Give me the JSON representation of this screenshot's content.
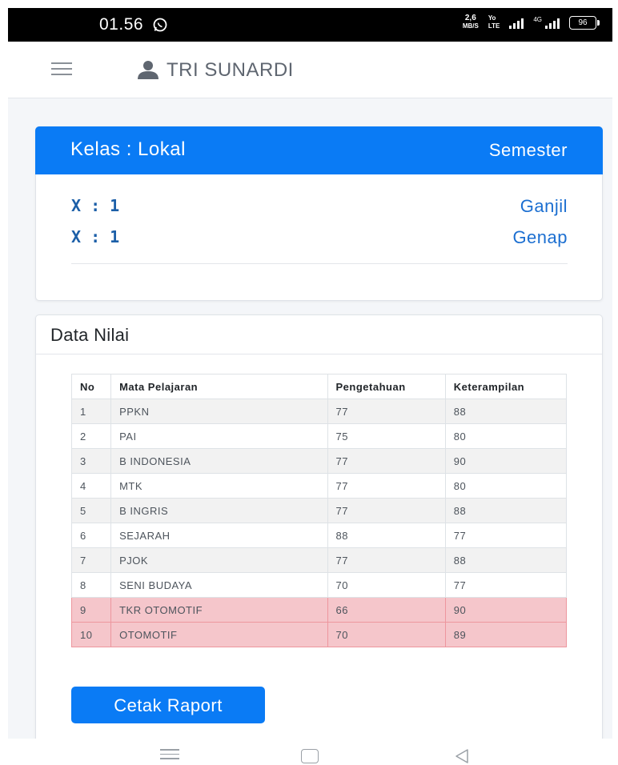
{
  "status_bar": {
    "time": "01.56",
    "speed_value": "2,6",
    "speed_unit": "MB/S",
    "lte_top": "Yo",
    "lte_bottom": "LTE",
    "network": "4G",
    "battery": "96"
  },
  "header": {
    "user_name": "TRI SUNARDI"
  },
  "kelas_card": {
    "title": "Kelas : Lokal",
    "semester_label": "Semester",
    "rows": [
      {
        "kelas": "X : 1",
        "semester": "Ganjil"
      },
      {
        "kelas": "X : 1",
        "semester": "Genap"
      }
    ]
  },
  "nilai_card": {
    "title": "Data Nilai",
    "columns": [
      "No",
      "Mata Pelajaran",
      "Pengetahuan",
      "Keterampilan"
    ],
    "rows": [
      {
        "no": "1",
        "mapel": "PPKN",
        "pengetahuan": "77",
        "keterampilan": "88"
      },
      {
        "no": "2",
        "mapel": "PAI",
        "pengetahuan": "75",
        "keterampilan": "80"
      },
      {
        "no": "3",
        "mapel": "B INDONESIA",
        "pengetahuan": "77",
        "keterampilan": "90"
      },
      {
        "no": "4",
        "mapel": "MTK",
        "pengetahuan": "77",
        "keterampilan": "80"
      },
      {
        "no": "5",
        "mapel": "B INGRIS",
        "pengetahuan": "77",
        "keterampilan": "88"
      },
      {
        "no": "6",
        "mapel": "SEJARAH",
        "pengetahuan": "88",
        "keterampilan": "77"
      },
      {
        "no": "7",
        "mapel": "PJOK",
        "pengetahuan": "77",
        "keterampilan": "88"
      },
      {
        "no": "8",
        "mapel": "SENI BUDAYA",
        "pengetahuan": "70",
        "keterampilan": "77"
      },
      {
        "no": "9",
        "mapel": "TKR OTOMOTIF",
        "pengetahuan": "66",
        "keterampilan": "90"
      },
      {
        "no": "10",
        "mapel": "OTOMOTIF",
        "pengetahuan": "70",
        "keterampilan": "89"
      }
    ],
    "print_button": "Cetak Raport"
  },
  "icons": {
    "menu": "hamburger-menu-icon",
    "user": "user-icon",
    "whatsapp": "whatsapp-icon",
    "nav_menu": "recent-apps-icon",
    "nav_home": "home-icon",
    "nav_back": "back-icon"
  },
  "colors": {
    "primary": "#0a7bf5",
    "link": "#1c6fd1",
    "danger_row": "#f5c6cb"
  }
}
